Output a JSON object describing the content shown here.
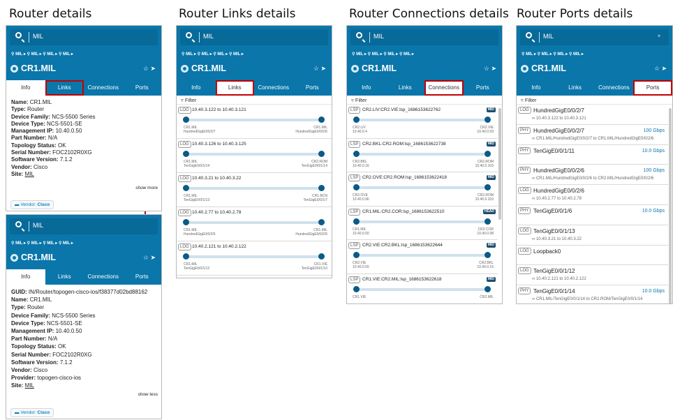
{
  "headings": {
    "router": "Router details",
    "links": "Router Links details",
    "connections": "Router Connections details",
    "ports": "Router Ports details"
  },
  "common": {
    "search_value": "MIL",
    "crumb": "MIL",
    "router_name": "CR1.MIL",
    "star_icon": "☆",
    "locate_icon": "➤",
    "filter_label": "Filter",
    "tabs": [
      "Info",
      "Links",
      "Connections",
      "Ports"
    ]
  },
  "info_short": {
    "rows": [
      {
        "k": "Name:",
        "v": "CR1.MIL"
      },
      {
        "k": "Type:",
        "v": "Router"
      },
      {
        "k": "Device Family:",
        "v": "NCS-5500 Series"
      },
      {
        "k": "Device Type:",
        "v": "NCS-5501-SE"
      },
      {
        "k": "Management IP:",
        "v": "10.40.0.50"
      },
      {
        "k": "Part Number:",
        "v": "N/A"
      },
      {
        "k": "Topology Status:",
        "v": "OK"
      },
      {
        "k": "Serial Number:",
        "v": "FOC2102R0XG"
      },
      {
        "k": "Software Version:",
        "v": "7.1.2"
      },
      {
        "k": "Vendor:",
        "v": "Cisco"
      },
      {
        "k": "Site:",
        "v": "MIL"
      }
    ],
    "show_more": "show more",
    "vendor_chip_label": "Vendor:",
    "vendor_chip_value": "Cisco"
  },
  "info_long": {
    "rows": [
      {
        "k": "GUID:",
        "v": "IN/Router/topogen-cisco-ios/f38377d02bd88162"
      },
      {
        "k": "Name:",
        "v": "CR1.MIL"
      },
      {
        "k": "Type:",
        "v": "Router"
      },
      {
        "k": "Device Family:",
        "v": "NCS-5500 Series"
      },
      {
        "k": "Device Type:",
        "v": "NCS-5501-SE"
      },
      {
        "k": "Management IP:",
        "v": "10.40.0.50"
      },
      {
        "k": "Part Number:",
        "v": "N/A"
      },
      {
        "k": "Topology Status:",
        "v": "OK"
      },
      {
        "k": "Serial Number:",
        "v": "FOC2102R0XG"
      },
      {
        "k": "Software Version:",
        "v": "7.1.2"
      },
      {
        "k": "Vendor:",
        "v": "Cisco"
      },
      {
        "k": "Provider:",
        "v": "topogen-cisco-ios"
      },
      {
        "k": "Site:",
        "v": "MIL"
      }
    ],
    "show_less": "show less",
    "vendor_chip_label": "Vendor:",
    "vendor_chip_value": "Cisco"
  },
  "links": [
    {
      "badge": "LOG",
      "title": "10.40.3.122 to 10.40.3.121",
      "a1": "CR1.MIL",
      "a2": "HundredGigE0/0/2/7",
      "b1": "CR1.MIL",
      "b2": "HundredGigE0/0/2/6"
    },
    {
      "badge": "LOG",
      "title": "10.40.3.126 to 10.40.3.125",
      "a1": "CR1.MIL",
      "a2": "TenGigE0/0/1/14",
      "b1": "CR2.ROM",
      "b2": "TenGigE0/0/1/14"
    },
    {
      "badge": "LOG",
      "title": "10.40.3.21 to 10.40.3.22",
      "a1": "CR1.MIL",
      "a2": "TenGigE0/0/1/13",
      "b1": "CR1.BCN",
      "b2": "TenGigE0/0/1/7"
    },
    {
      "badge": "LOG",
      "title": "10.40.2.77 to 10.40.2.78",
      "a1": "CR1.MIL",
      "a2": "HundredGigE0/0/2/6",
      "b1": "CR1.MIL",
      "b2": "HundredGigE0/0/2/6"
    },
    {
      "badge": "LOG",
      "title": "10.40.2.121 to 10.40.2.122",
      "a1": "CR1.MIL",
      "a2": "TenGigE0/0/1/12",
      "b1": "CR1.VIE",
      "b2": "TenGigE0/0/1/10"
    }
  ],
  "connections": [
    {
      "badge": "LSP",
      "title": "CR2.LIV:CR2.VIE:lsp_1686153622762",
      "status": "MID",
      "a1": "CR2.LIV",
      "a2": "10.40.0.4",
      "b1": "CR2.VIE",
      "b2": "10.40.0.59"
    },
    {
      "badge": "LSP",
      "title": "CR2.BKL:CR2.ROM:lsp_1686153622738",
      "status": "MID",
      "a1": "CR2.BKL",
      "a2": "10.40.0.16",
      "b1": "CR2.ROM",
      "b2": "10.40.0.103"
    },
    {
      "badge": "LSP",
      "title": "CR2.OVE:CR2.ROM:lsp_1686153622418",
      "status": "MID",
      "a1": "CR2.OVE",
      "a2": "10.40.0.96",
      "b1": "CR2.ROM",
      "b2": "10.40.0.103"
    },
    {
      "badge": "LSP",
      "title": "CR1.MIL:CR2.COR:lsp_1686153622510",
      "status": "HEAD",
      "a1": "CR1.MIL",
      "a2": "10.40.0.50",
      "b1": "CR2.COR",
      "b2": "10.40.0.98"
    },
    {
      "badge": "LSP",
      "title": "CR2.VIE:CR2.BKL:lsp_1686153622644",
      "status": "MID",
      "a1": "CR2.VIE",
      "a2": "10.40.0.55",
      "b1": "CR2.BKL",
      "b2": "10.40.0.16"
    },
    {
      "badge": "LSP",
      "title": "CR1.VIE:CR2.MIL:lsp_1686153622618",
      "status": "MID",
      "a1": "CR1.VIE",
      "a2": "",
      "b1": "CR2.MIL",
      "b2": ""
    }
  ],
  "ports": [
    {
      "badge": "LOG",
      "name": "HundredGigE0/0/2/7",
      "speed": "",
      "sub": "10.40.3.122 to 10.40.3.121"
    },
    {
      "badge": "PHY",
      "name": "HundredGigE0/0/2/7",
      "speed": "100 Gbps",
      "sub": "CR1.MIL/HundredGigE0/0/2/7 to CR1.MIL/HundredGigE0/0/2/6"
    },
    {
      "badge": "PHY",
      "name": "TenGigE0/0/1/11",
      "speed": "10.0 Gbps",
      "sub": ""
    },
    {
      "badge": "PHY",
      "name": "HundredGigE0/0/2/6",
      "speed": "100 Gbps",
      "sub": "CR1.MIL/HundredGigE0/0/2/6 to CR2.MIL/HundredGigE0/0/2/6"
    },
    {
      "badge": "LOG",
      "name": "HundredGigE0/0/2/6",
      "speed": "",
      "sub": "10.40.2.77 to 10.40.2.78"
    },
    {
      "badge": "PHY",
      "name": "TenGigE0/0/1/6",
      "speed": "10.0 Gbps",
      "sub": ""
    },
    {
      "badge": "LOG",
      "name": "TenGigE0/0/1/13",
      "speed": "",
      "sub": "10.40.3.21 to 10.40.3.22"
    },
    {
      "badge": "LOG",
      "name": "Loopback0",
      "speed": "",
      "sub": ""
    },
    {
      "badge": "LOG",
      "name": "TenGigE0/0/1/12",
      "speed": "",
      "sub": "10.40.2.121 to 10.40.2.122"
    },
    {
      "badge": "PHY",
      "name": "TenGigE0/0/1/14",
      "speed": "10.0 Gbps",
      "sub": "CR1.MIL/TenGigE0/0/1/14 to CR2.ROM/TenGigE0/0/1/14"
    }
  ]
}
